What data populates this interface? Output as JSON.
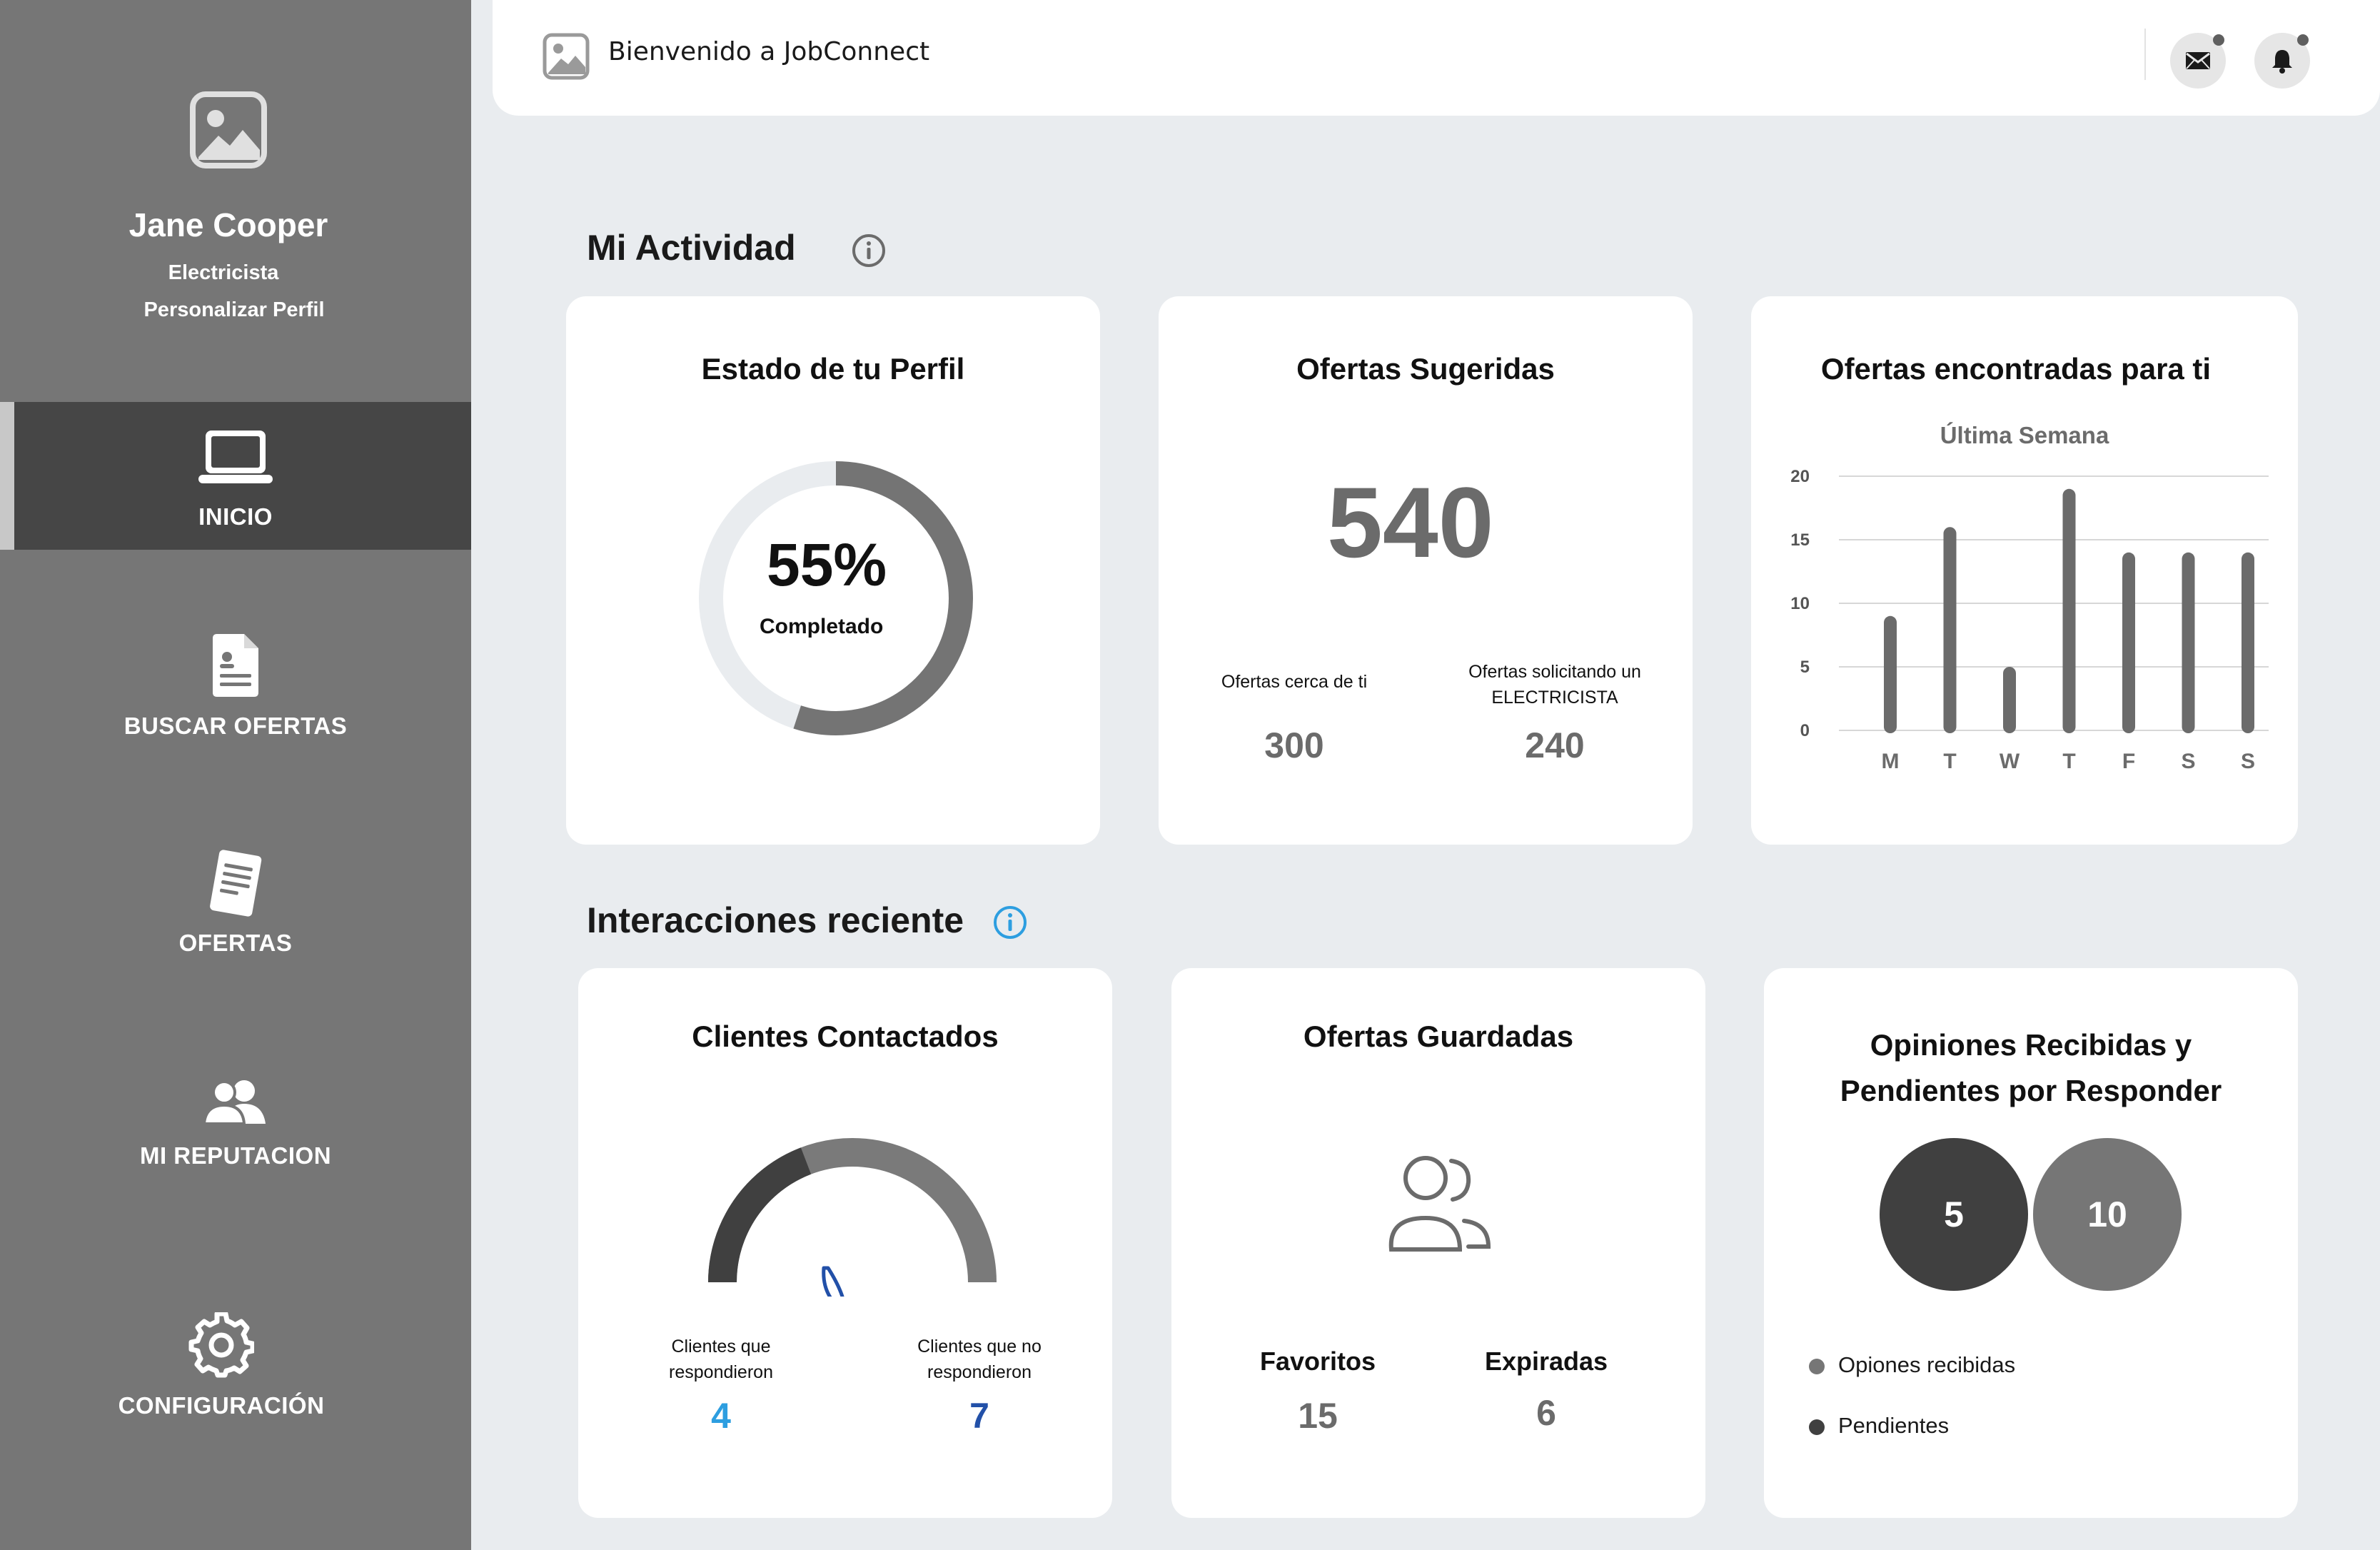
{
  "sidebar": {
    "name": "Jane Cooper",
    "role": "Electricista",
    "customize_link": "Personalizar Perfil",
    "items": [
      {
        "label": "INICIO",
        "icon": "laptop-icon",
        "active": true
      },
      {
        "label": "BUSCAR OFERTAS",
        "icon": "document-icon",
        "active": false
      },
      {
        "label": "OFERTAS",
        "icon": "note-icon",
        "active": false
      },
      {
        "label": "MI REPUTACION",
        "icon": "users-icon",
        "active": false
      },
      {
        "label": "CONFIGURACIÓN",
        "icon": "gear-icon",
        "active": false
      }
    ]
  },
  "topbar": {
    "title": "Bienvenido a JobConnect",
    "icons": [
      "mail-icon",
      "bell-icon"
    ]
  },
  "activity": {
    "title": "Mi Actividad",
    "profile_status": {
      "title": "Estado de tu Perfil",
      "percent_label": "55%",
      "percent": 55,
      "sub": "Completado"
    },
    "suggested": {
      "title": "Ofertas Sugeridas",
      "total": "540",
      "near_label": "Ofertas cerca de ti",
      "near_value": "300",
      "requesting_label_1": "Ofertas solicitando un",
      "requesting_label_2": "ELECTRICISTA",
      "requesting_value": "240"
    },
    "found": {
      "title": "Ofertas encontradas para ti",
      "subtitle": "Última Semana"
    }
  },
  "chart_data": {
    "type": "bar",
    "title": "Ofertas encontradas para ti",
    "subtitle": "Última Semana",
    "categories": [
      "M",
      "T",
      "W",
      "T",
      "F",
      "S",
      "S"
    ],
    "values": [
      9,
      16,
      5,
      19,
      14,
      14,
      14
    ],
    "ylim": [
      0,
      20
    ],
    "yticks": [
      "0",
      "5",
      "10",
      "15",
      "20"
    ],
    "grid": true,
    "bar_color": "#6b6b6b"
  },
  "interactions": {
    "title": "Interacciones reciente",
    "clients": {
      "title": "Clientes Contactados",
      "responded_label_1": "Clientes que",
      "responded_label_2": "respondieron",
      "responded_value": "4",
      "not_responded_label_1": "Clientes que no",
      "not_responded_label_2": "respondieron",
      "not_responded_value": "7"
    },
    "saved": {
      "title": "Ofertas Guardadas",
      "fav_label": "Favoritos",
      "fav_value": "15",
      "exp_label": "Expiradas",
      "exp_value": "6"
    },
    "reviews": {
      "title_1": "Opiniones Recibidas y",
      "title_2": "Pendientes por Responder",
      "received_value": "5",
      "pending_value": "10",
      "legend_received": "Opiones recibidas",
      "legend_pending": "Pendientes"
    }
  },
  "colors": {
    "sidebar": "#767676",
    "active": "#464646",
    "accent_blue": "#2d9ee0",
    "accent_dark_blue": "#2250a8"
  }
}
